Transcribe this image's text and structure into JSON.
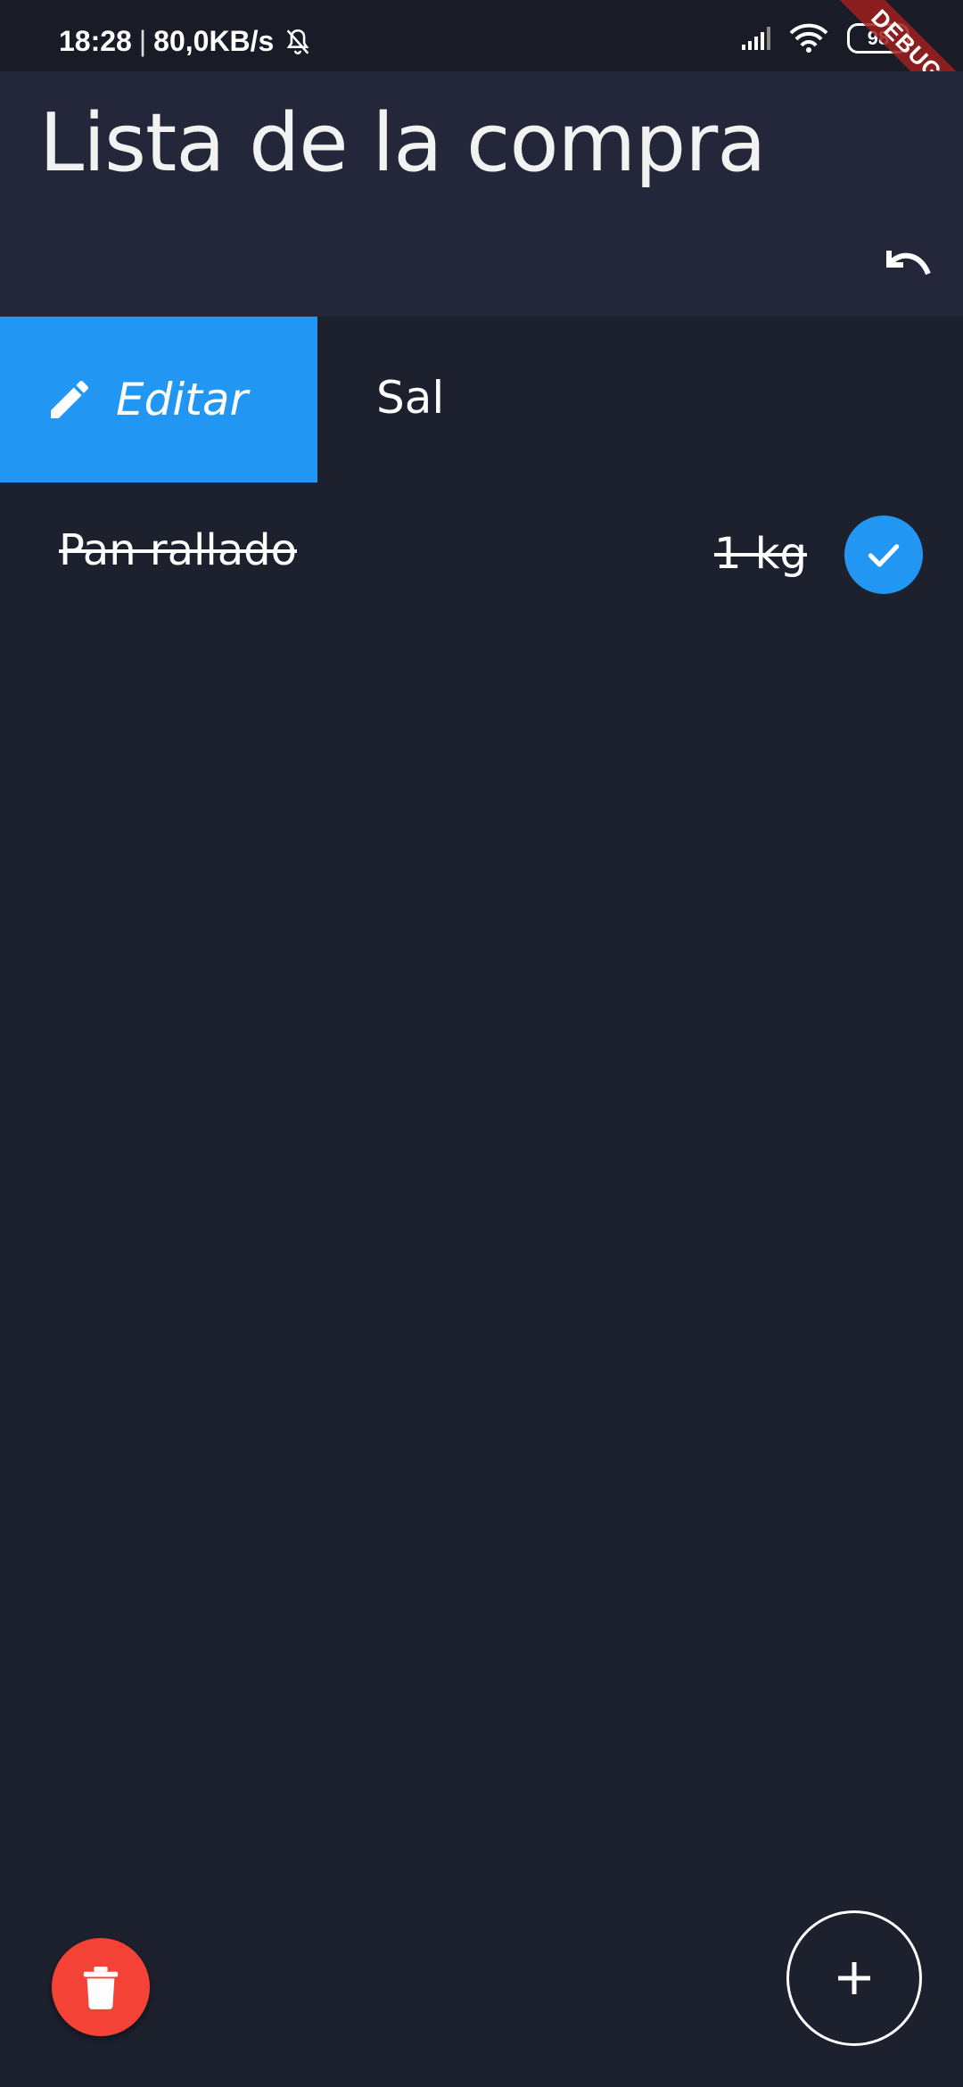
{
  "status_bar": {
    "time": "18:28",
    "separator": "|",
    "network_speed": "80,0KB/s",
    "battery": "98",
    "bell_icon": "bell-off-icon",
    "signal_icon": "signal-icon",
    "wifi_icon": "wifi-icon"
  },
  "debug_banner": "DEBUG",
  "app_bar": {
    "title": "Lista de la compra",
    "undo_icon": "undo-icon"
  },
  "swiped_item": {
    "action_label": "Editar",
    "action_icon": "pencil-icon",
    "action_color": "#2196f3",
    "name": "Sal"
  },
  "items": [
    {
      "name": "Pan rallado",
      "quantity": "1 kg",
      "checked": true
    }
  ],
  "fab": {
    "delete_icon": "trash-icon",
    "delete_color": "#f44336",
    "add_icon": "plus-icon"
  },
  "colors": {
    "background": "#1d202d",
    "app_bar": "#242739",
    "accent": "#2196f3"
  }
}
